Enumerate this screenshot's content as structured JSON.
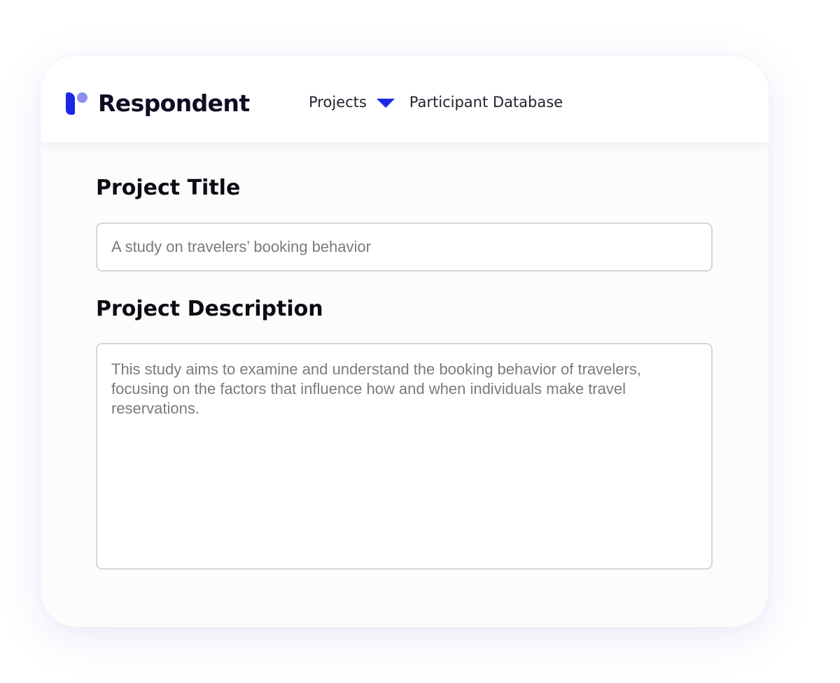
{
  "app": {
    "brand_name": "Respondent",
    "brand_colors": {
      "primary": "#1c27e8",
      "secondary": "#8c8ff2"
    }
  },
  "navbar": {
    "items": [
      {
        "label": "Projects",
        "has_dropdown": true,
        "dropdown_icon": "caret-down-icon"
      },
      {
        "label": "Participant Database"
      }
    ]
  },
  "form": {
    "title_label": "Project Title",
    "title_value": "A study on travelers’ booking behavior",
    "description_label": "Project Description",
    "description_value": "This study aims to examine and understand the booking behavior of travelers, focusing on the factors that influence how and when individuals make travel reservations."
  }
}
